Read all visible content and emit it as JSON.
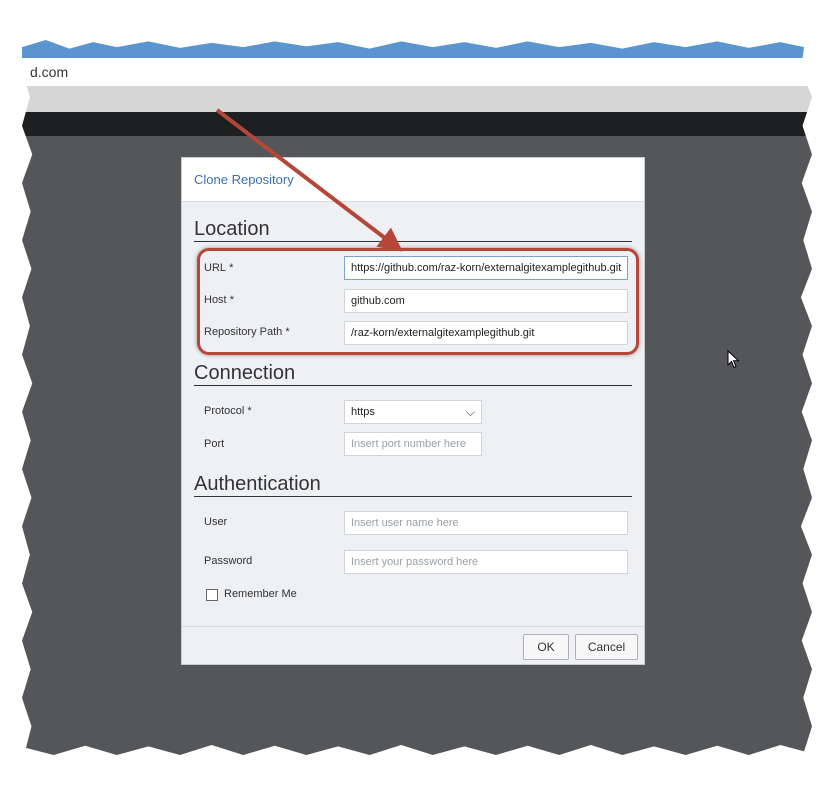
{
  "browser": {
    "address_text": "d.com"
  },
  "dialog": {
    "title": "Clone Repository",
    "sections": {
      "location": "Location",
      "connection": "Connection",
      "authentication": "Authentication"
    },
    "location": {
      "url_label": "URL",
      "url_value": "https://github.com/raz-korn/externalgitexamplegithub.git",
      "host_label": "Host",
      "host_value": "github.com",
      "path_label": "Repository Path",
      "path_value": "/raz-korn/externalgitexamplegithub.git"
    },
    "connection": {
      "protocol_label": "Protocol",
      "protocol_value": "https",
      "port_label": "Port",
      "port_placeholder": "Insert port number here"
    },
    "authentication": {
      "user_label": "User",
      "user_placeholder": "Insert user name here",
      "password_label": "Password",
      "password_placeholder": "Insert your password here",
      "remember_label": "Remember Me"
    },
    "required_marker": "*",
    "buttons": {
      "ok": "OK",
      "cancel": "Cancel"
    }
  },
  "colors": {
    "annotation": "#b5473a",
    "link_blue": "#3b73af"
  }
}
